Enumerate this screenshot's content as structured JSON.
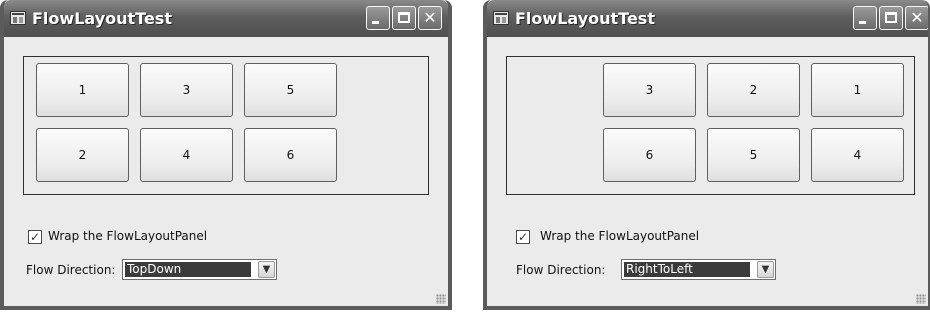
{
  "windows": [
    {
      "title": "FlowLayoutTest",
      "buttons": [
        "1",
        "3",
        "5",
        "2",
        "4",
        "6"
      ],
      "wrap_checkbox": {
        "label": "Wrap the FlowLayoutPanel",
        "checked": true,
        "mark": "✓"
      },
      "flow_direction": {
        "label": "Flow Direction:",
        "value": "TopDown"
      }
    },
    {
      "title": "FlowLayoutTest",
      "buttons": [
        "3",
        "2",
        "1",
        "6",
        "5",
        "4"
      ],
      "wrap_checkbox": {
        "label": "Wrap the FlowLayoutPanel",
        "checked": true,
        "mark": "✓"
      },
      "flow_direction": {
        "label": "Flow Direction:",
        "value": "RightToLeft"
      }
    }
  ],
  "caption_buttons": {
    "close": "✕"
  },
  "icons": [
    "app-form-icon",
    "minimize-icon",
    "maximize-icon",
    "close-icon",
    "checkmark-icon",
    "dropdown-arrow-icon",
    "resize-grip-icon"
  ]
}
